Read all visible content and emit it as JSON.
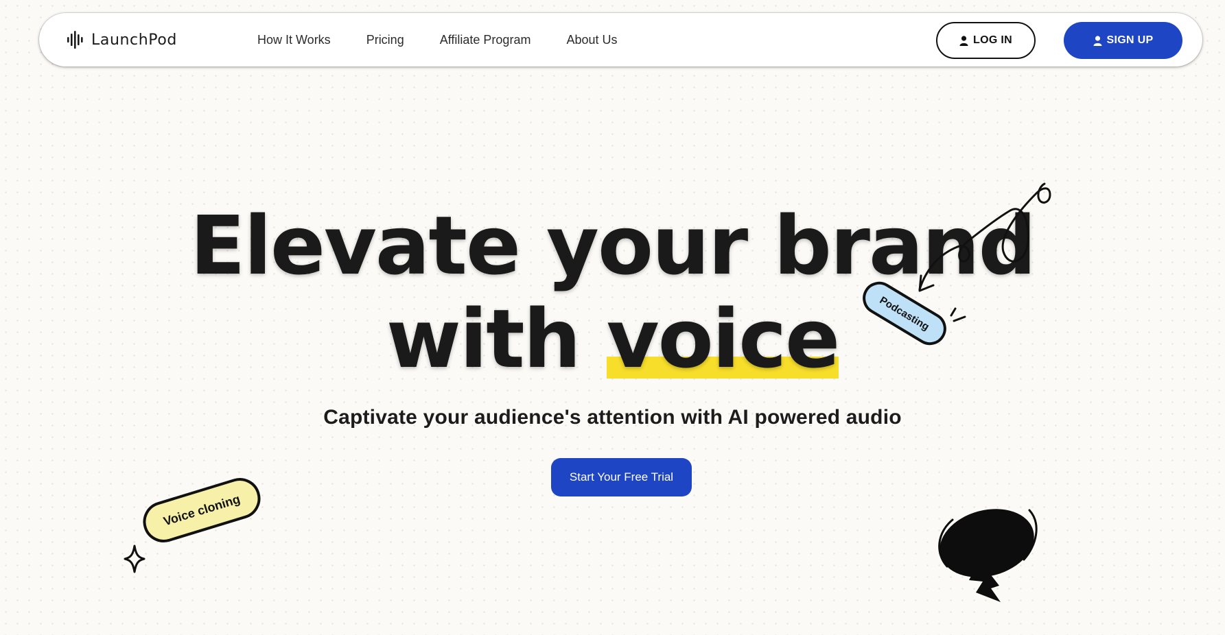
{
  "brand": {
    "name": "LaunchPod",
    "logo_icon": "sound-wave-icon"
  },
  "nav": {
    "links": [
      "How It Works",
      "Pricing",
      "Affiliate Program",
      "About Us"
    ],
    "login_label": "LOG IN",
    "signup_label": "SIGN UP",
    "user_icon": "user-icon"
  },
  "hero": {
    "title_line1": "Elevate your brand",
    "title_line2_prefix": "with ",
    "title_line2_highlight": "voice",
    "subtitle": "Captivate your audience's attention with AI powered audio",
    "cta_label": "Start Your Free Trial"
  },
  "stickers": {
    "podcasting": "Podcasting",
    "voice_cloning": "Voice cloning"
  },
  "colors": {
    "accent_blue": "#1d45c4",
    "highlight_yellow": "#f7de2a",
    "podcasting_blue": "#bfe1f7",
    "voice_yellow": "#f6f0a8",
    "background": "#fbfaf6"
  }
}
